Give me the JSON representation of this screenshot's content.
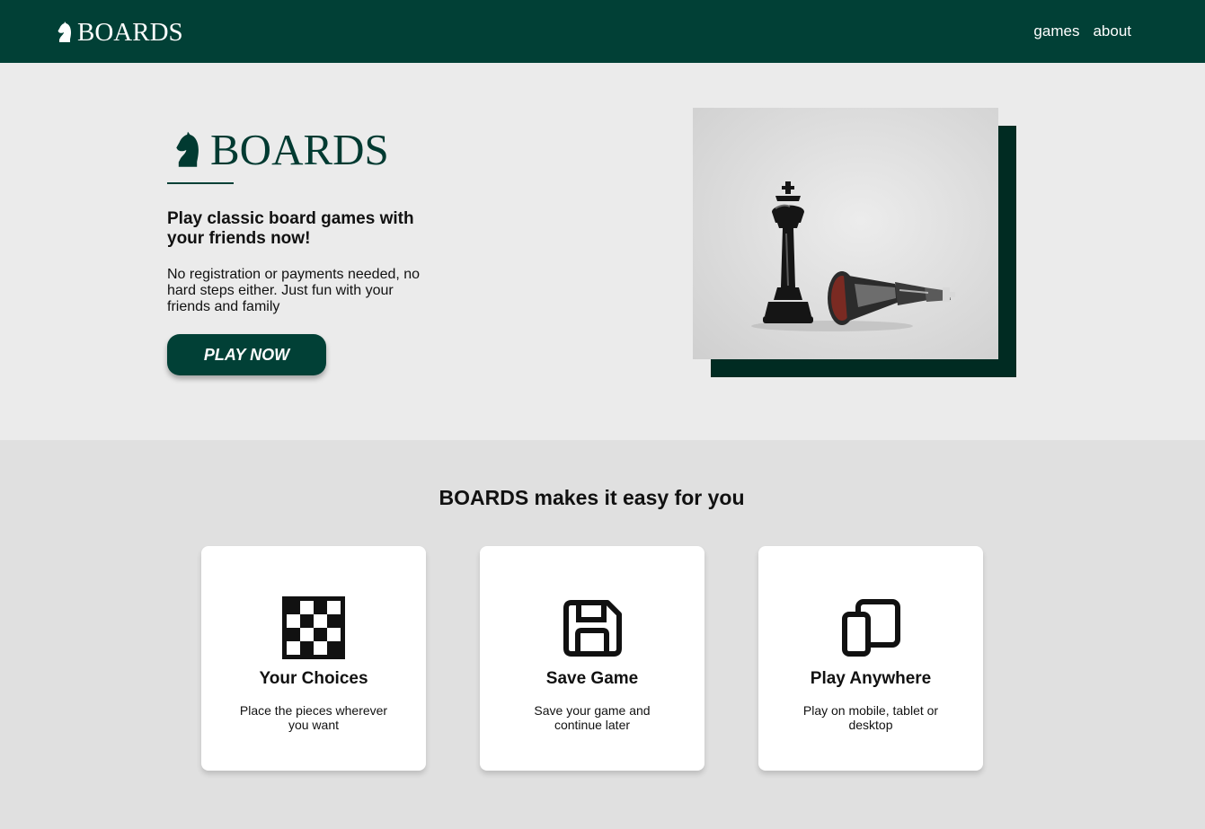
{
  "nav": {
    "brand": "BOARDS",
    "links": [
      "games",
      "about"
    ]
  },
  "hero": {
    "brand": "BOARDS",
    "heading": "Play classic board games with your friends now!",
    "text": "No registration or payments needed, no hard steps either. Just fun with your friends and family",
    "cta": "PLAY NOW"
  },
  "features": {
    "title": "BOARDS makes it easy for you",
    "cards": [
      {
        "title": "Your Choices",
        "text": "Place the pieces wherever you want",
        "icon": "checkerboard-icon"
      },
      {
        "title": "Save Game",
        "text": "Save your game and continue later",
        "icon": "floppy-disk-icon"
      },
      {
        "title": "Play Anywhere",
        "text": "Play on mobile, tablet or desktop",
        "icon": "devices-icon"
      }
    ]
  },
  "colors": {
    "primary": "#014036",
    "dark_accent": "#002b22",
    "hero_bg": "#ebebeb",
    "section_bg": "#e0e0e0"
  }
}
